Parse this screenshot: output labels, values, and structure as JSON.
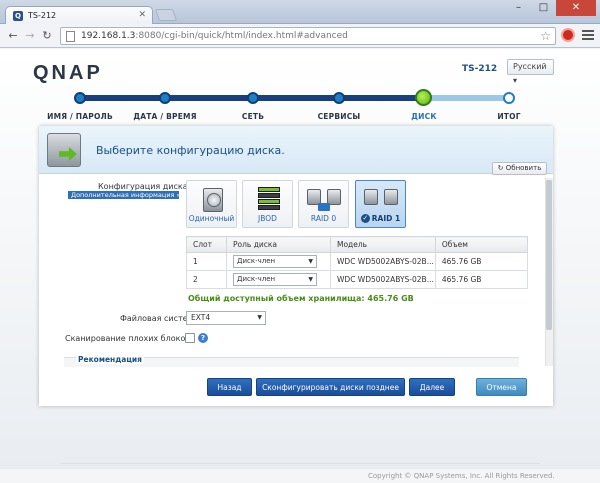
{
  "browser": {
    "tab_title": "TS-212",
    "tab_favicon": "Q",
    "url_host": "192.168.1.3",
    "url_rest": ":8080/cgi-bin/quick/html/index.html#advanced",
    "window_buttons": [
      "–",
      "□",
      "✕"
    ]
  },
  "header": {
    "logo": "QNAP",
    "model": "TS-212",
    "language": "Русский ▾"
  },
  "steps": [
    {
      "label": "ИМЯ / ПАРОЛЬ",
      "state": "done"
    },
    {
      "label": "ДАТА / ВРЕМЯ",
      "state": "done"
    },
    {
      "label": "СЕТЬ",
      "state": "done"
    },
    {
      "label": "СЕРВИСЫ",
      "state": "done"
    },
    {
      "label": "ДИСК",
      "state": "active"
    },
    {
      "label": "ИТОГ",
      "state": "future"
    }
  ],
  "panel": {
    "title": "Выберите конфигурацию диска.",
    "refresh_label": "Обновить",
    "config_label": "Конфигурация диска:",
    "advanced_link": "Дополнительная информация »",
    "raid_options": [
      {
        "label": "Одиночный",
        "icon": "single-disk-icon",
        "selected": false
      },
      {
        "label": "JBOD",
        "icon": "jbod-icon",
        "selected": false
      },
      {
        "label": "RAID 0",
        "icon": "raid0-icon",
        "selected": false
      },
      {
        "label": "RAID 1",
        "icon": "raid1-icon",
        "selected": true
      }
    ],
    "table": {
      "headers": [
        "Слот",
        "Роль диска",
        "Модель",
        "Объем"
      ],
      "rows": [
        {
          "slot": "1",
          "role": "Диск-член",
          "model": "WDC WD5002ABYS-02B...",
          "size": "465.76 GB"
        },
        {
          "slot": "2",
          "role": "Диск-член",
          "model": "WDC WD5002ABYS-02B...",
          "size": "465.76 GB"
        }
      ]
    },
    "total": "Общий доступный объем хранилища: 465.76 GB",
    "fs_label": "Файловая система:",
    "fs_value": "EXT4",
    "scan_label": "Сканирование плохих блоков:",
    "scan_checked": false,
    "recommendation_label": "Рекомендация"
  },
  "buttons": {
    "back": "Назад",
    "later": "Сконфигурировать диски позднее",
    "next": "Далее",
    "cancel": "Отмена"
  },
  "footer": {
    "copyright": "Copyright © QNAP Systems, Inc. All Rights Reserved."
  },
  "colors": {
    "accent": "#1a4e99",
    "progress_done": "#1a3f7e",
    "active_step": "#59b50f",
    "total_text": "#4a8c18"
  }
}
